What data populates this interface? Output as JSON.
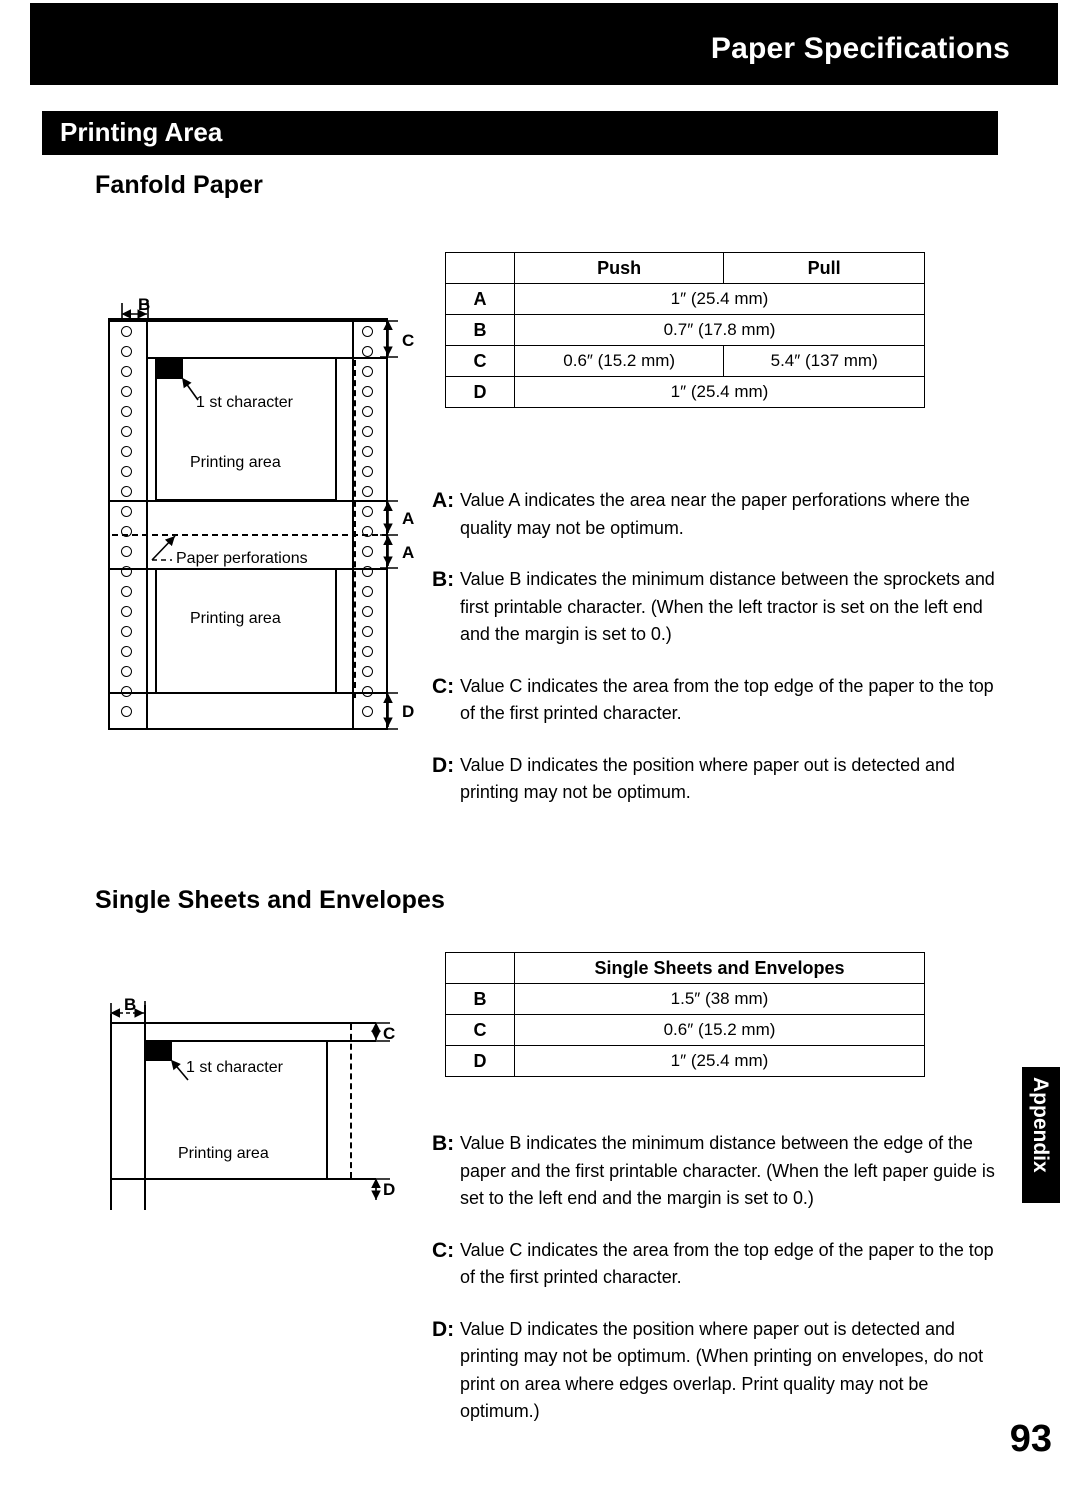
{
  "header": {
    "title": "Paper Specifications",
    "section": "Printing Area"
  },
  "sections": {
    "fanfold": {
      "heading": "Fanfold Paper",
      "table": {
        "corner": "",
        "columns": [
          "Push",
          "Pull"
        ],
        "rows": [
          {
            "label": "A",
            "span": true,
            "values": [
              "1″ (25.4 mm)"
            ]
          },
          {
            "label": "B",
            "span": true,
            "values": [
              "0.7″ (17.8 mm)"
            ]
          },
          {
            "label": "C",
            "span": false,
            "values": [
              "0.6″ (15.2 mm)",
              "5.4″ (137 mm)"
            ]
          },
          {
            "label": "D",
            "span": true,
            "values": [
              "1″ (25.4 mm)"
            ]
          }
        ]
      },
      "descriptions": [
        {
          "key": "A:",
          "text": "Value A indicates the area near the paper perforations where the quality may not be optimum."
        },
        {
          "key": "B:",
          "text": "Value B indicates the minimum distance between the sprockets and first printable character. (When the left tractor is set on the left end and the margin is set to 0.)"
        },
        {
          "key": "C:",
          "text": "Value C indicates the area from the top edge of the paper to the top of the first printed character."
        },
        {
          "key": "D:",
          "text": "Value D indicates the position where paper out is detected and printing may not be optimum."
        }
      ],
      "diagram": {
        "label_b": "B",
        "label_c": "C",
        "label_a_upper": "A",
        "label_a_lower": "A",
        "label_d": "D",
        "first_character": "1 st character",
        "printing_area_upper": "Printing area",
        "printing_area_lower": "Printing area",
        "perforations": "Paper perforations"
      }
    },
    "single": {
      "heading": "Single Sheets and Envelopes",
      "table": {
        "corner": "",
        "columns": [
          "Single Sheets and Envelopes"
        ],
        "rows": [
          {
            "label": "B",
            "values": [
              "1.5″ (38 mm)"
            ]
          },
          {
            "label": "C",
            "values": [
              "0.6″ (15.2 mm)"
            ]
          },
          {
            "label": "D",
            "values": [
              "1″ (25.4 mm)"
            ]
          }
        ]
      },
      "descriptions": [
        {
          "key": "B:",
          "text": "Value B indicates the minimum distance between the edge of the paper and the first printable character. (When the left paper guide is set to the left end and the margin is set to 0.)"
        },
        {
          "key": "C:",
          "text": "Value C indicates the area from the top edge of the paper to the top of the first printed character."
        },
        {
          "key": "D:",
          "text": "Value D indicates the position where paper out is detected and printing may not be optimum. (When printing on envelopes, do not print on area where edges overlap. Print quality may not be optimum.)"
        }
      ],
      "diagram": {
        "label_b": "B",
        "label_c": "C",
        "label_d": "D",
        "first_character": "1 st character",
        "printing_area": "Printing area"
      }
    }
  },
  "footer": {
    "appendix_tab": "Appendix",
    "page_number": "93"
  },
  "colors": {
    "ink": "#000000",
    "paper": "#ffffff"
  }
}
